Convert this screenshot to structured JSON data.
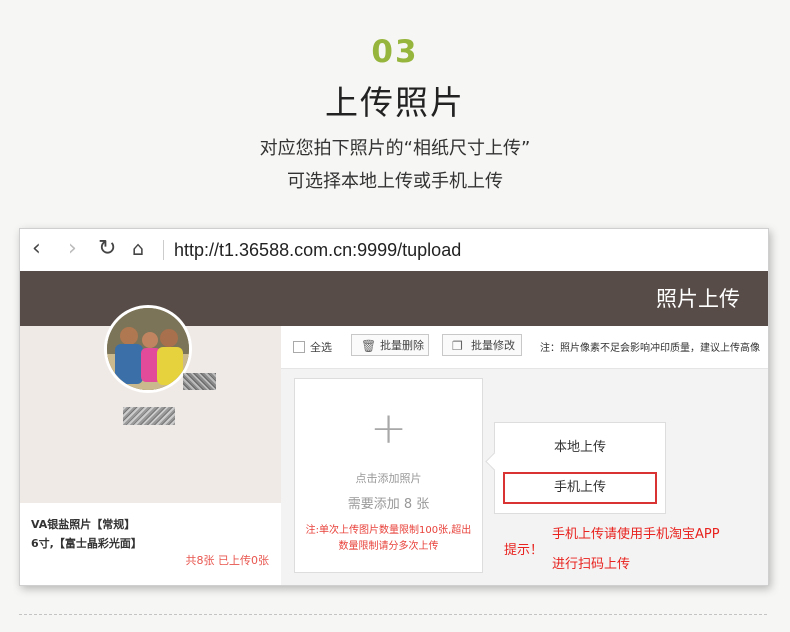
{
  "step": {
    "number": "03",
    "title": "上传照片"
  },
  "description": {
    "line1": "对应您拍下照片的“相纸尺寸上传”",
    "line2": "可选择本地上传或手机上传"
  },
  "browser": {
    "url": "http://t1.36588.com.cn:9999/tupload",
    "icons": [
      "back-icon",
      "forward-icon",
      "reload-icon",
      "home-icon"
    ]
  },
  "app": {
    "header_title": "照片上传"
  },
  "product": {
    "name": "VA银盐照片【常规】",
    "spec": "6寸,【富士晶彩光面】",
    "count": "共8张 已上传0张"
  },
  "toolbar": {
    "select_all": "全选",
    "batch_delete": "批量删除",
    "batch_edit": "批量修改",
    "notice": "注：照片像素不足会影响冲印质量，建议上传高像"
  },
  "upload": {
    "add_text": "点击添加照片",
    "need_text": "需要添加 8 张",
    "limit_note": "注:单次上传图片数量限制100张,超出数量限制请分多次上传"
  },
  "popup": {
    "local_upload": "本地上传",
    "mobile_upload": "手机上传"
  },
  "tip": {
    "label": "提示！",
    "line1": "手机上传请使用手机淘宝APP",
    "line2": "进行扫码上传"
  },
  "colors": {
    "accent_green": "#96b53c",
    "header_brown": "#574c47",
    "alert_red": "#e8221e"
  }
}
